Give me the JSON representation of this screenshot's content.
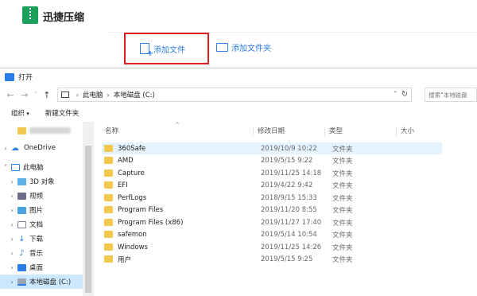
{
  "app": {
    "title": "迅捷压缩",
    "add_file": "添加文件",
    "add_folder": "添加文件夹"
  },
  "dialog": {
    "title": "打开",
    "nav": {
      "back": "←",
      "forward": "→",
      "recent": "˅",
      "up": "↑"
    },
    "address": {
      "root": "此电脑",
      "drive": "本地磁盘 (C:)",
      "separator": "›"
    },
    "search_placeholder": "搜索\"本地磁盘",
    "toolbar": {
      "organize": "组织",
      "new_folder": "新建文件夹"
    },
    "nav_items": [
      {
        "label": "",
        "icon": "folder-icon",
        "expandable": false
      },
      {
        "label": "OneDrive",
        "icon": "cloud-icon",
        "expandable": true
      },
      {
        "label": "此电脑",
        "icon": "computer-icon",
        "expandable": true,
        "expanded": true
      },
      {
        "label": "3D 对象",
        "icon": "3d-objects-icon",
        "expandable": true
      },
      {
        "label": "视频",
        "icon": "video-icon",
        "expandable": true
      },
      {
        "label": "图片",
        "icon": "picture-icon",
        "expandable": true
      },
      {
        "label": "文档",
        "icon": "document-icon",
        "expandable": true
      },
      {
        "label": "下载",
        "icon": "download-icon",
        "expandable": true
      },
      {
        "label": "音乐",
        "icon": "music-icon",
        "expandable": true
      },
      {
        "label": "桌面",
        "icon": "desktop-icon",
        "expandable": true
      },
      {
        "label": "本地磁盘 (C:)",
        "icon": "drive-icon",
        "expandable": true,
        "selected": true
      }
    ],
    "columns": {
      "name": "名称",
      "modified": "修改日期",
      "type": "类型",
      "size": "大小"
    },
    "files": [
      {
        "name": "360Safe",
        "modified": "2019/10/9 10:22",
        "type": "文件夹",
        "selected": true
      },
      {
        "name": "AMD",
        "modified": "2019/5/15 9:22",
        "type": "文件夹"
      },
      {
        "name": "Capture",
        "modified": "2019/11/25 14:18",
        "type": "文件夹"
      },
      {
        "name": "EFI",
        "modified": "2019/4/22 9:42",
        "type": "文件夹"
      },
      {
        "name": "PerfLogs",
        "modified": "2018/9/15 15:33",
        "type": "文件夹"
      },
      {
        "name": "Program Files",
        "modified": "2019/11/20 8:55",
        "type": "文件夹"
      },
      {
        "name": "Program Files (x86)",
        "modified": "2019/11/27 17:40",
        "type": "文件夹"
      },
      {
        "name": "safemon",
        "modified": "2019/5/14 10:54",
        "type": "文件夹"
      },
      {
        "name": "Windows",
        "modified": "2019/11/25 14:26",
        "type": "文件夹"
      },
      {
        "name": "用户",
        "modified": "2019/5/15 9:25",
        "type": "文件夹"
      }
    ]
  }
}
